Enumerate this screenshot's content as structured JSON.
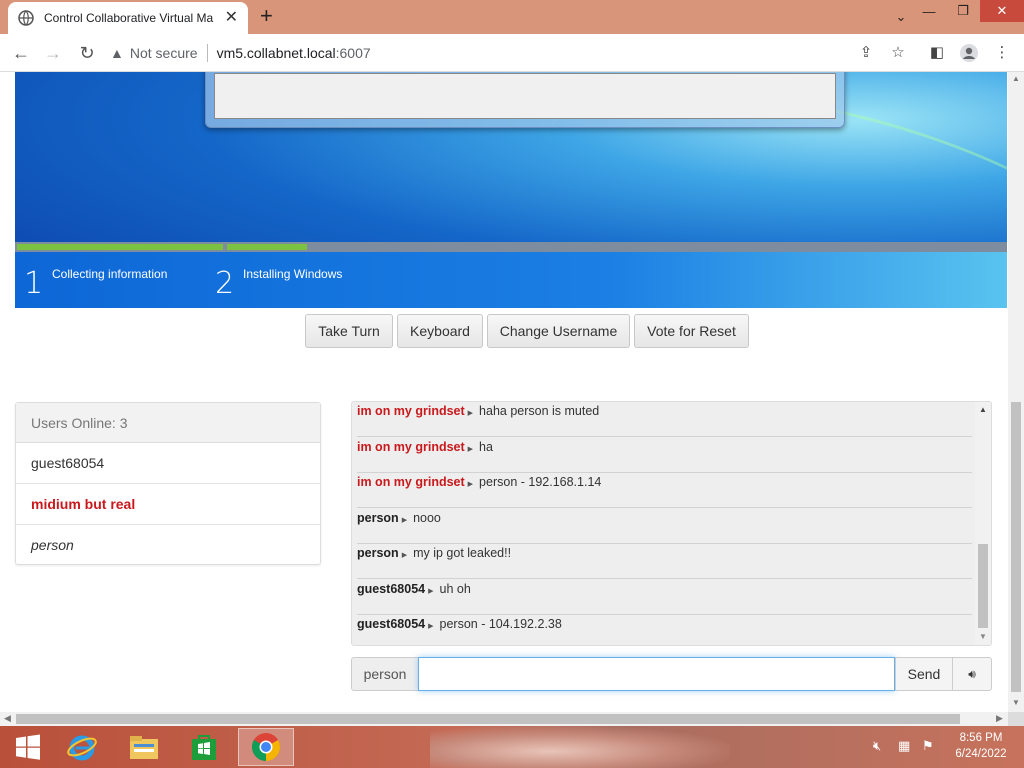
{
  "browser": {
    "tab_title": "Control Collaborative Virtual Ma",
    "security_label": "Not secure",
    "url_host": "vm5.collabnet.local",
    "url_port": ":6007"
  },
  "vm_screen": {
    "steps": [
      {
        "number": "1",
        "label": "Collecting information"
      },
      {
        "number": "2",
        "label": "Installing Windows"
      }
    ],
    "progress": [
      1.0,
      0.5
    ]
  },
  "controls": {
    "take_turn": "Take Turn",
    "keyboard": "Keyboard",
    "change_username": "Change Username",
    "vote_reset": "Vote for Reset"
  },
  "users_panel": {
    "header": "Users Online: 3",
    "users": [
      {
        "name": "guest68054",
        "style": "normal"
      },
      {
        "name": "midium but real",
        "style": "red-bold"
      },
      {
        "name": "person",
        "style": "italic"
      }
    ]
  },
  "chat": {
    "messages": [
      {
        "nick": "im on my grindset",
        "text": "haha person is muted",
        "color": "#c9191c"
      },
      {
        "nick": "im on my grindset",
        "text": "ha",
        "color": "#c9191c"
      },
      {
        "nick": "im on my grindset",
        "text": "person - 192.168.1.14",
        "color": "#c9191c"
      },
      {
        "nick": "person",
        "text": "nooo",
        "color": "#222222"
      },
      {
        "nick": "person",
        "text": "my ip got leaked!!",
        "color": "#222222"
      },
      {
        "nick": "guest68054",
        "text": "uh oh",
        "color": "#222222"
      },
      {
        "nick": "guest68054",
        "text": "person - 104.192.2.38",
        "color": "#222222"
      }
    ],
    "username": "person",
    "input_value": "",
    "send_label": "Send"
  },
  "taskbar": {
    "time": "8:56 PM",
    "date": "6/24/2022"
  },
  "colors": {
    "titlebar": "#d9957a",
    "user_highlight": "#c9191c",
    "input_focus": "#66afe9"
  }
}
